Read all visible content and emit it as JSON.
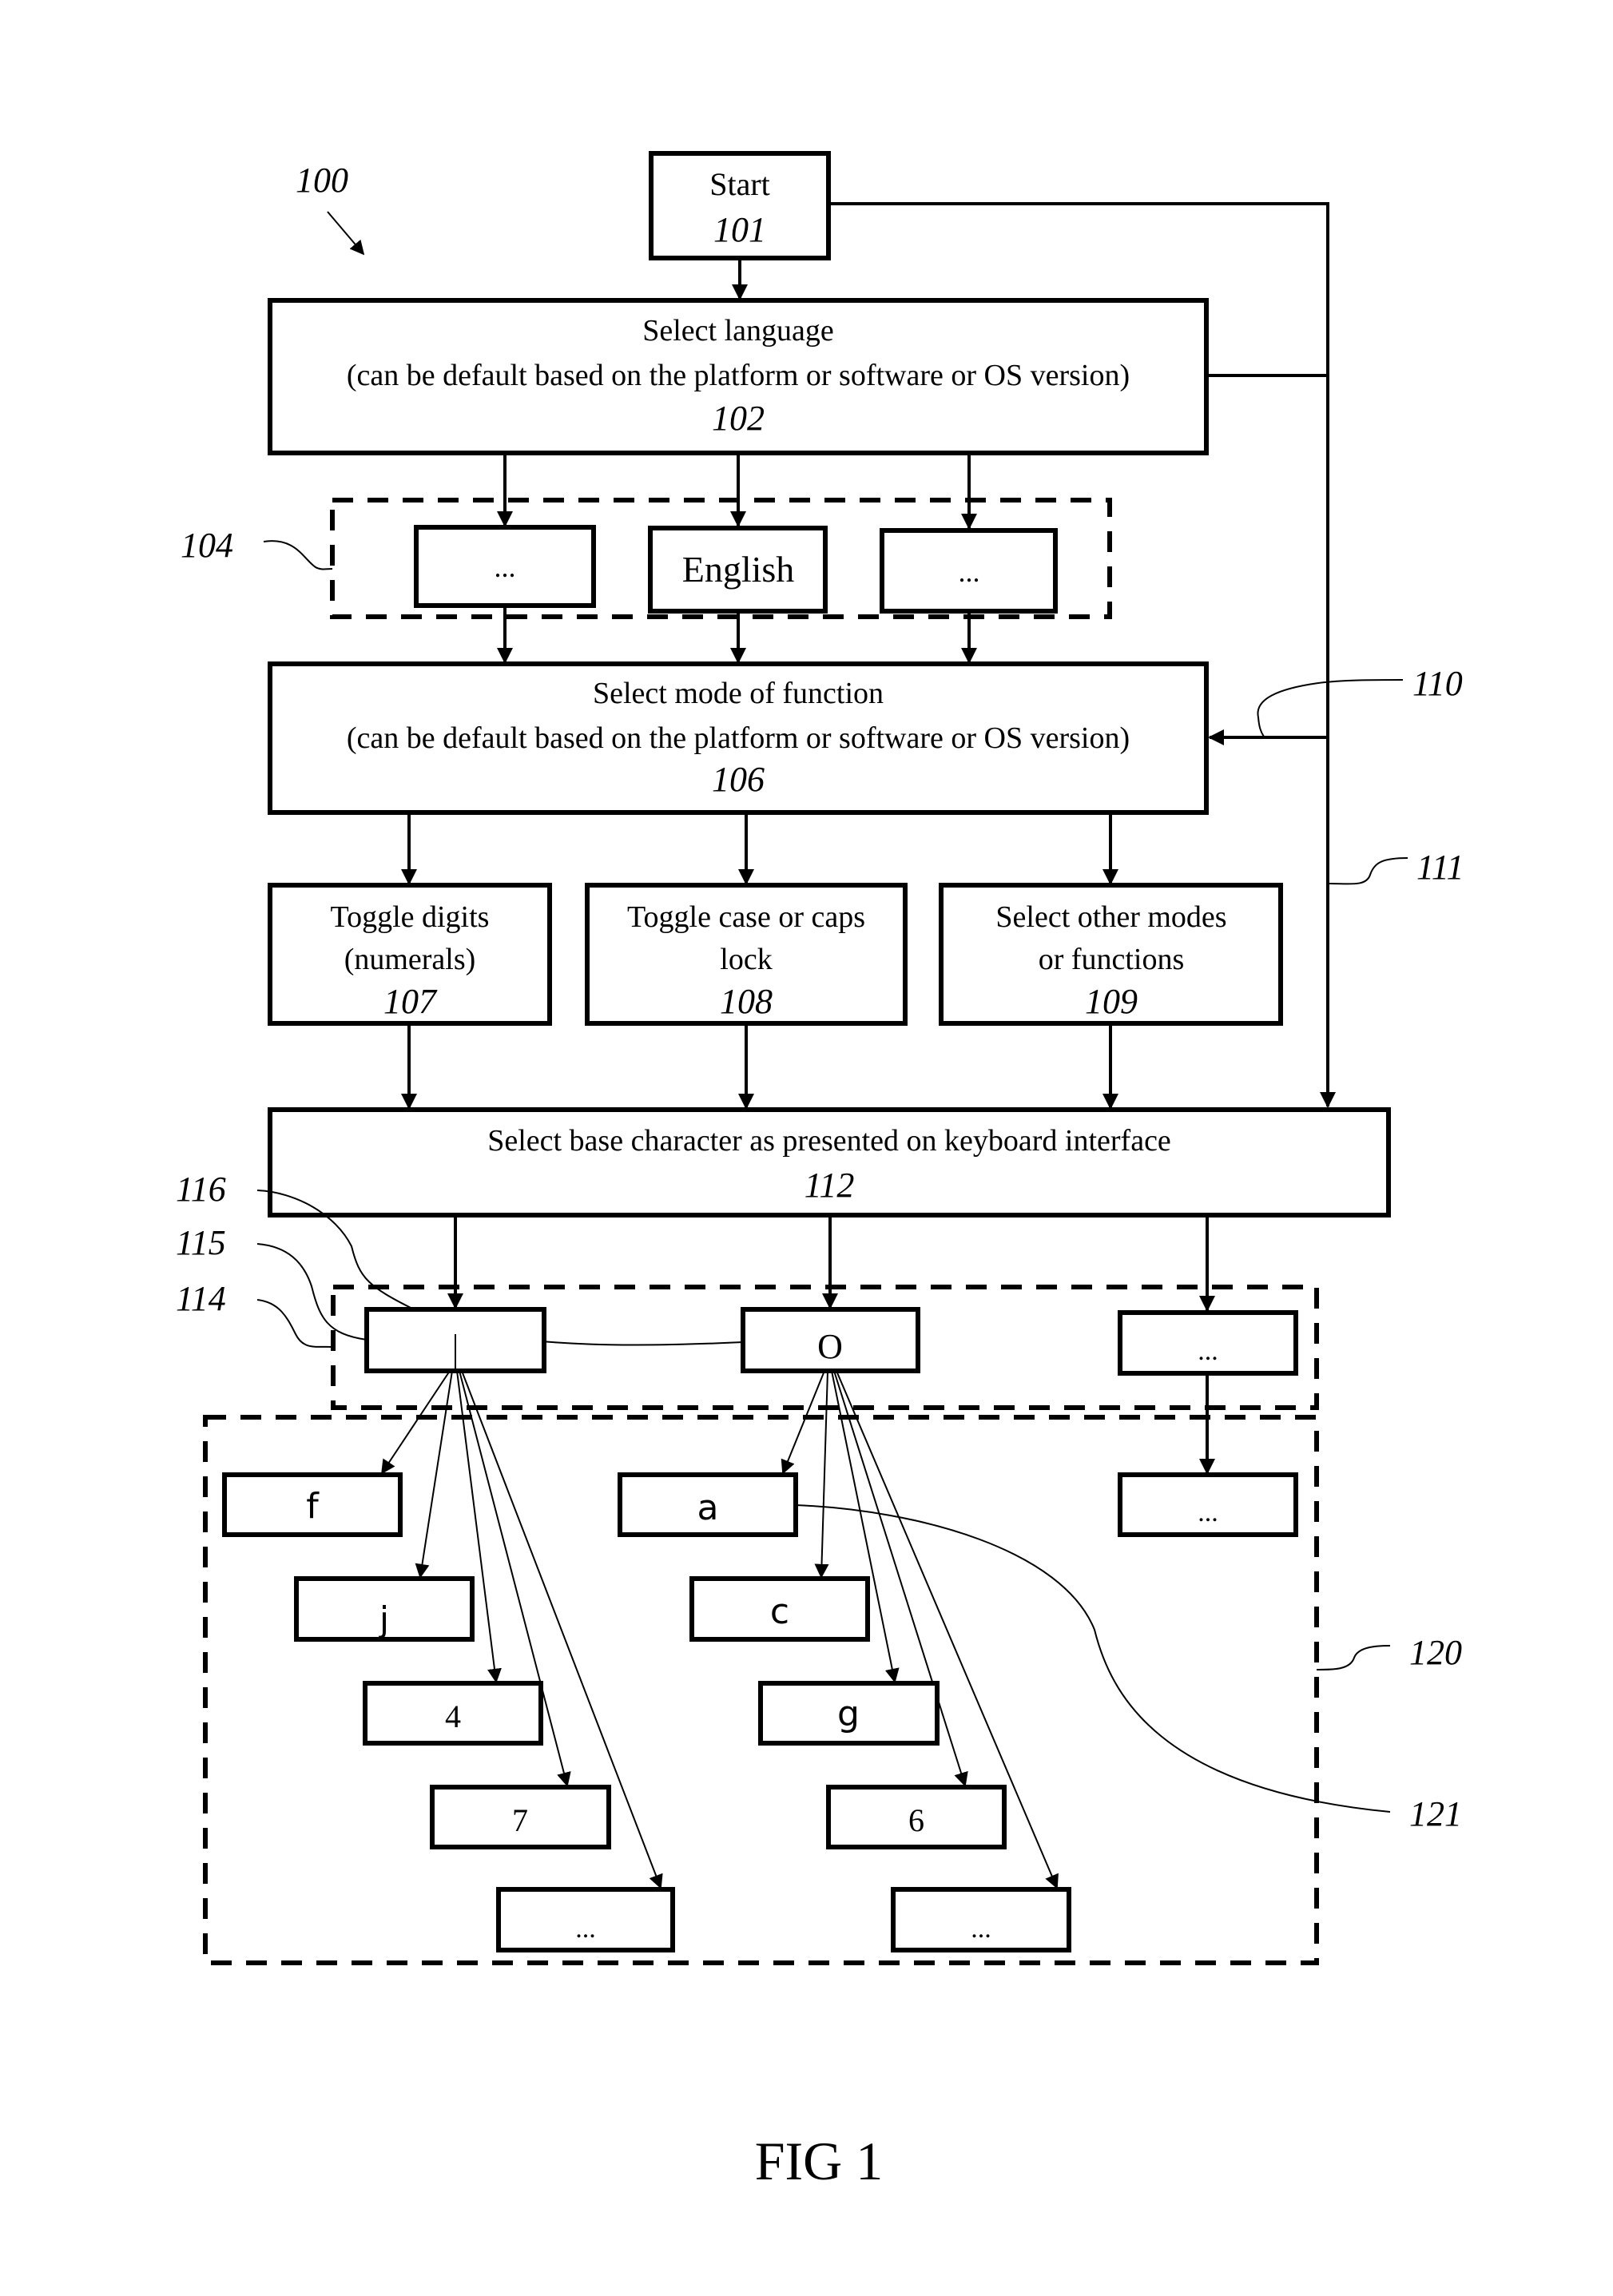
{
  "figure": {
    "ref": "100",
    "caption": "FIG 1",
    "start": {
      "label": "Start",
      "ref": "101"
    },
    "select_language": {
      "line1": "Select language",
      "line2": "(can be default based on the platform or software or OS version)",
      "ref": "102"
    },
    "languages": {
      "ref": "104",
      "options": [
        "...",
        "English",
        "..."
      ]
    },
    "select_mode": {
      "line1": "Select mode of function",
      "line2": "(can be default based on the platform or software or OS version)",
      "ref": "106"
    },
    "modes": [
      {
        "line1": "Toggle digits",
        "line2": "(numerals)",
        "ref": "107"
      },
      {
        "line1": "Toggle case or caps",
        "line2": "lock",
        "ref": "108"
      },
      {
        "line1": "Select other modes",
        "line2": "or functions",
        "ref": "109"
      }
    ],
    "bypass_refs": {
      "to_mode": "110",
      "to_base": "111"
    },
    "select_base": {
      "line1": "Select base character as presented on keyboard interface",
      "ref": "112"
    },
    "base_characters": {
      "refs": [
        "114",
        "115",
        "116"
      ],
      "items": [
        "|",
        "O",
        "..."
      ]
    },
    "variants": {
      "ref": "120",
      "item_ref": "121",
      "column_1": [
        "f",
        "j",
        "4",
        "7",
        "..."
      ],
      "column_2": [
        "a",
        "c",
        "g",
        "6",
        "..."
      ],
      "column_3": [
        "..."
      ]
    }
  }
}
